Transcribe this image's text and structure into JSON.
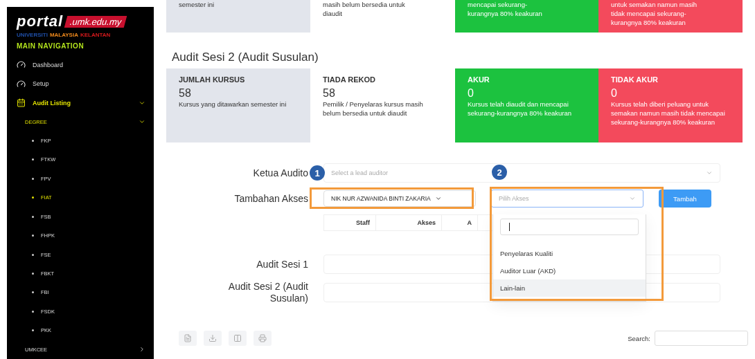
{
  "sidebar": {
    "logo": {
      "portal": "portal",
      "domain": ".umk.edu.my"
    },
    "university": [
      {
        "text": "UNIVERSITI",
        "color": "#1f4fa8"
      },
      {
        "text": "MALAYSIA",
        "color": "#f08a1c"
      },
      {
        "text": "KELANTAN",
        "color": "#d7191c"
      }
    ],
    "section_title": "MAIN NAVIGATION",
    "items": [
      {
        "label": "Dashboard",
        "selected": false
      },
      {
        "label": "Setup",
        "selected": false
      },
      {
        "label": "Audit Listing",
        "selected": true,
        "expanded": true,
        "children": [
          {
            "label": "DEGREE",
            "selected": true,
            "expanded": true,
            "children": [
              {
                "label": "FKP",
                "selected": false
              },
              {
                "label": "FTKW",
                "selected": false
              },
              {
                "label": "FPV",
                "selected": false
              },
              {
                "label": "FIAT",
                "selected": true
              },
              {
                "label": "FSB",
                "selected": false
              },
              {
                "label": "FHPK",
                "selected": false
              },
              {
                "label": "FSE",
                "selected": false
              },
              {
                "label": "FBKT",
                "selected": false
              },
              {
                "label": "FBI",
                "selected": false
              },
              {
                "label": "FSDK",
                "selected": false
              },
              {
                "label": "PKK",
                "selected": false
              }
            ]
          },
          {
            "label": "UMKCEE",
            "selected": false,
            "expanded": false
          }
        ]
      }
    ]
  },
  "previous_cards": [
    {
      "kind": "neutral",
      "lines": [
        "semester ini"
      ]
    },
    {
      "kind": "plain",
      "lines": [
        "masih belum bersedia untuk",
        "diaudit"
      ]
    },
    {
      "kind": "success",
      "lines": [
        "mencapai sekurang-",
        "kurangnya 80% keakuran"
      ]
    },
    {
      "kind": "danger",
      "lines": [
        "untuk semakan namun masih",
        "tidak mencapai sekurang-",
        "kurangnya 80% keakuran"
      ]
    }
  ],
  "section_title": "Audit Sesi 2 (Audit Susulan)",
  "cards": [
    {
      "kind": "neutral",
      "title": "JUMLAH KURSUS",
      "value": "58",
      "description": "Kursus yang ditawarkan semester ini"
    },
    {
      "kind": "plain",
      "title": "TIADA REKOD",
      "value": "58",
      "description": "Pemilik / Penyelaras kursus masih belum bersedia untuk diaudit"
    },
    {
      "kind": "success",
      "title": "AKUR",
      "value": "0",
      "description": "Kursus telah diaudit dan mencapai sekurang-kurangnya 80% keakuran"
    },
    {
      "kind": "danger",
      "title": "TIDAK AKUR",
      "value": "0",
      "description": "Kursus telah diberi peluang untuk semakan namun masih tidak mencapai sekurang-kurangnya 80% keakuran"
    }
  ],
  "form": {
    "lead_auditor": {
      "label": "Ketua Audito",
      "placeholder": "Select a lead auditor"
    },
    "additional_access": {
      "label": "Tambahan Akses",
      "staff_value": "NIK NUR AZWANIDA BINTI ZAKARIA",
      "access_select": {
        "placeholder": "Pilih Akses",
        "expanded": true,
        "options": [
          {
            "label": "Penyelaras Kualiti",
            "selected": false
          },
          {
            "label": "Auditor Luar (AKD)",
            "selected": false
          },
          {
            "label": "Lain-lain",
            "selected": true
          }
        ]
      },
      "button": "Tambah"
    },
    "access_table_columns": [
      "Staff",
      "Akses",
      "A"
    ],
    "sessions": [
      {
        "label": "Audit Sesi 1"
      },
      {
        "label": "Audit Sesi 2 (Audit Susulan)"
      }
    ]
  },
  "callouts": [
    "1",
    "2"
  ],
  "search": {
    "label": "Search:"
  }
}
